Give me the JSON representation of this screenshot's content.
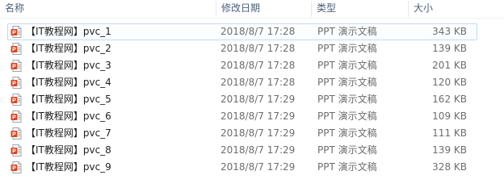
{
  "columns": {
    "name": "名称",
    "date": "修改日期",
    "type": "类型",
    "size": "大小",
    "sort_indicator": "^"
  },
  "colors": {
    "ppt_icon": "#d24726",
    "focus_border": "#c3d9f3",
    "header_text": "#4c607a",
    "secondary_text": "#6d6d6d"
  },
  "files": [
    {
      "name": "【IT教程网】pvc_1",
      "date": "2018/8/7 17:28",
      "type": "PPT 演示文稿",
      "size": "343 KB",
      "icon": "ppt-file-icon"
    },
    {
      "name": "【IT教程网】pvc_2",
      "date": "2018/8/7 17:28",
      "type": "PPT 演示文稿",
      "size": "139 KB",
      "icon": "ppt-file-icon"
    },
    {
      "name": "【IT教程网】pvc_3",
      "date": "2018/8/7 17:28",
      "type": "PPT 演示文稿",
      "size": "201 KB",
      "icon": "ppt-file-icon"
    },
    {
      "name": "【IT教程网】pvc_4",
      "date": "2018/8/7 17:28",
      "type": "PPT 演示文稿",
      "size": "120 KB",
      "icon": "ppt-file-icon"
    },
    {
      "name": "【IT教程网】pvc_5",
      "date": "2018/8/7 17:29",
      "type": "PPT 演示文稿",
      "size": "162 KB",
      "icon": "ppt-file-icon"
    },
    {
      "name": "【IT教程网】pvc_6",
      "date": "2018/8/7 17:29",
      "type": "PPT 演示文稿",
      "size": "109 KB",
      "icon": "ppt-file-icon"
    },
    {
      "name": "【IT教程网】pvc_7",
      "date": "2018/8/7 17:29",
      "type": "PPT 演示文稿",
      "size": "111 KB",
      "icon": "ppt-file-icon"
    },
    {
      "name": "【IT教程网】pvc_8",
      "date": "2018/8/7 17:29",
      "type": "PPT 演示文稿",
      "size": "139 KB",
      "icon": "ppt-file-icon"
    },
    {
      "name": "【IT教程网】pvc_9",
      "date": "2018/8/7 17:29",
      "type": "PPT 演示文稿",
      "size": "328 KB",
      "icon": "ppt-file-icon"
    }
  ]
}
